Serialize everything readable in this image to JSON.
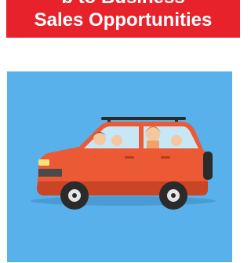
{
  "banner": {
    "line1": "b to Business",
    "line2": "Sales Opportunities"
  },
  "illustration": {
    "subject": "car-with-family-icon",
    "background_color": "#58b1ea",
    "car_color": "#ec5a35"
  },
  "colors": {
    "banner_bg": "#e8222b",
    "banner_text": "#ffffff"
  }
}
